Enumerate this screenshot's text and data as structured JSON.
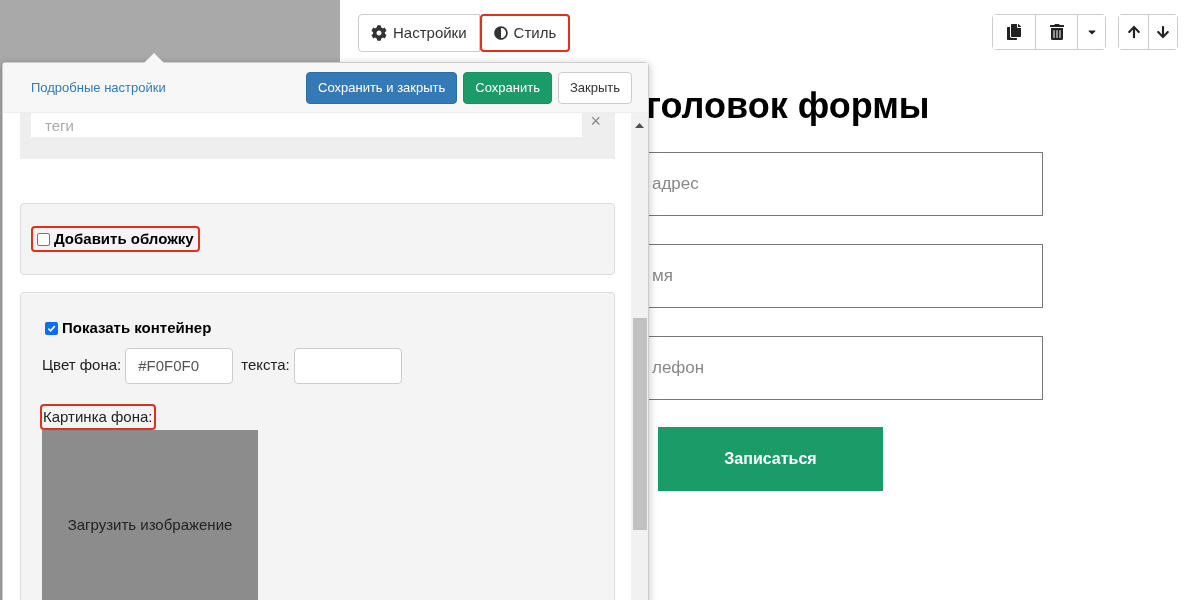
{
  "tabs": [
    {
      "label": "Настройки",
      "highlighted": false
    },
    {
      "label": "Стиль",
      "highlighted": true
    }
  ],
  "form": {
    "heading": "головок формы",
    "fields": [
      {
        "placeholder": "адрес"
      },
      {
        "placeholder": "мя"
      },
      {
        "placeholder": "лефон"
      }
    ],
    "submit": "Записаться"
  },
  "popup": {
    "link": "Подробные настройки",
    "buttons": [
      {
        "label": "Сохранить и закрыть",
        "kind": "primary"
      },
      {
        "label": "Сохранить",
        "kind": "success"
      },
      {
        "label": "Закрыть",
        "kind": "default"
      }
    ],
    "tags_field": {
      "placeholder": "теги",
      "clear": "×"
    },
    "cover": {
      "label": "Добавить обложку",
      "checked": false,
      "highlighted": true
    },
    "container": {
      "label": "Показать контейнер",
      "checked": true,
      "highlighted": false
    },
    "bg_color": {
      "label": "Цвет фона:",
      "value": "#F0F0F0"
    },
    "text_color": {
      "label": "текста:"
    },
    "bg_image": {
      "label": "Картинка фона:",
      "highlighted": true,
      "upload": "Загрузить изображение"
    }
  }
}
